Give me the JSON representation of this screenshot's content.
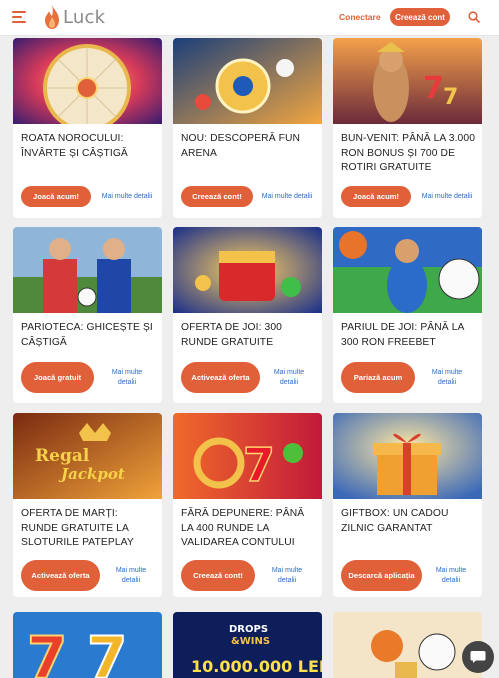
{
  "header": {
    "logo_text": "Luck",
    "login_label": "Conectare",
    "register_label": "Creează cont"
  },
  "promos": [
    {
      "title": "ROATA NOROCULUI: ÎNVÂRTE ȘI CÂȘTIGĂ",
      "cta": "Joacă acum!",
      "more": "Mai multe detalii"
    },
    {
      "title": "NOU: DESCOPERĂ FUN ARENA",
      "cta": "Creează cont!",
      "more": "Mai multe detalii"
    },
    {
      "title": "BUN-VENIT: PÂNĂ LA 3.000 RON BONUS ȘI 700 DE ROTIRI GRATUITE",
      "cta": "Joacă acum!",
      "more": "Mai multe detalii"
    },
    {
      "title": "PARIOTECA: GHICEȘTE ȘI CÂȘTIGĂ",
      "cta": "Joacă gratuit",
      "more": "Mai multe detalii"
    },
    {
      "title": "OFERTA DE JOI: 300 RUNDE GRATUITE",
      "cta": "Activează oferta",
      "more": "Mai multe detalii"
    },
    {
      "title": "PARIUL DE JOI: PÂNĂ LA 300 RON FREEBET",
      "cta": "Pariază acum",
      "more": "Mai multe detalii"
    },
    {
      "title": "OFERTA DE MARȚI: RUNDE GRATUITE LA SLOTURILE PATEPLAY",
      "cta": "Activează oferta",
      "more": "Mai multe detalii"
    },
    {
      "title": "FĂRĂ DEPUNERE: PÂNĂ LA 400 RUNDE LA VALIDAREA CONTULUI",
      "cta": "Creează cont!",
      "more": "Mai multe detalii"
    },
    {
      "title": "GIFTBOX: UN CADOU ZILNIC GARANTAT",
      "cta": "Descarcă aplicația",
      "more": "Mai multe detalii"
    }
  ],
  "images": {
    "regal_logo_line1": "Regal",
    "regal_logo_line2": "Jackpot",
    "drops_logo_line1": "DROPS",
    "drops_logo_line2": "&WINS",
    "drops_amount": "10.000.000 LEI"
  },
  "colors": {
    "accent": "#e0603a",
    "link": "#2a6cc8",
    "background": "#eeeeee"
  }
}
